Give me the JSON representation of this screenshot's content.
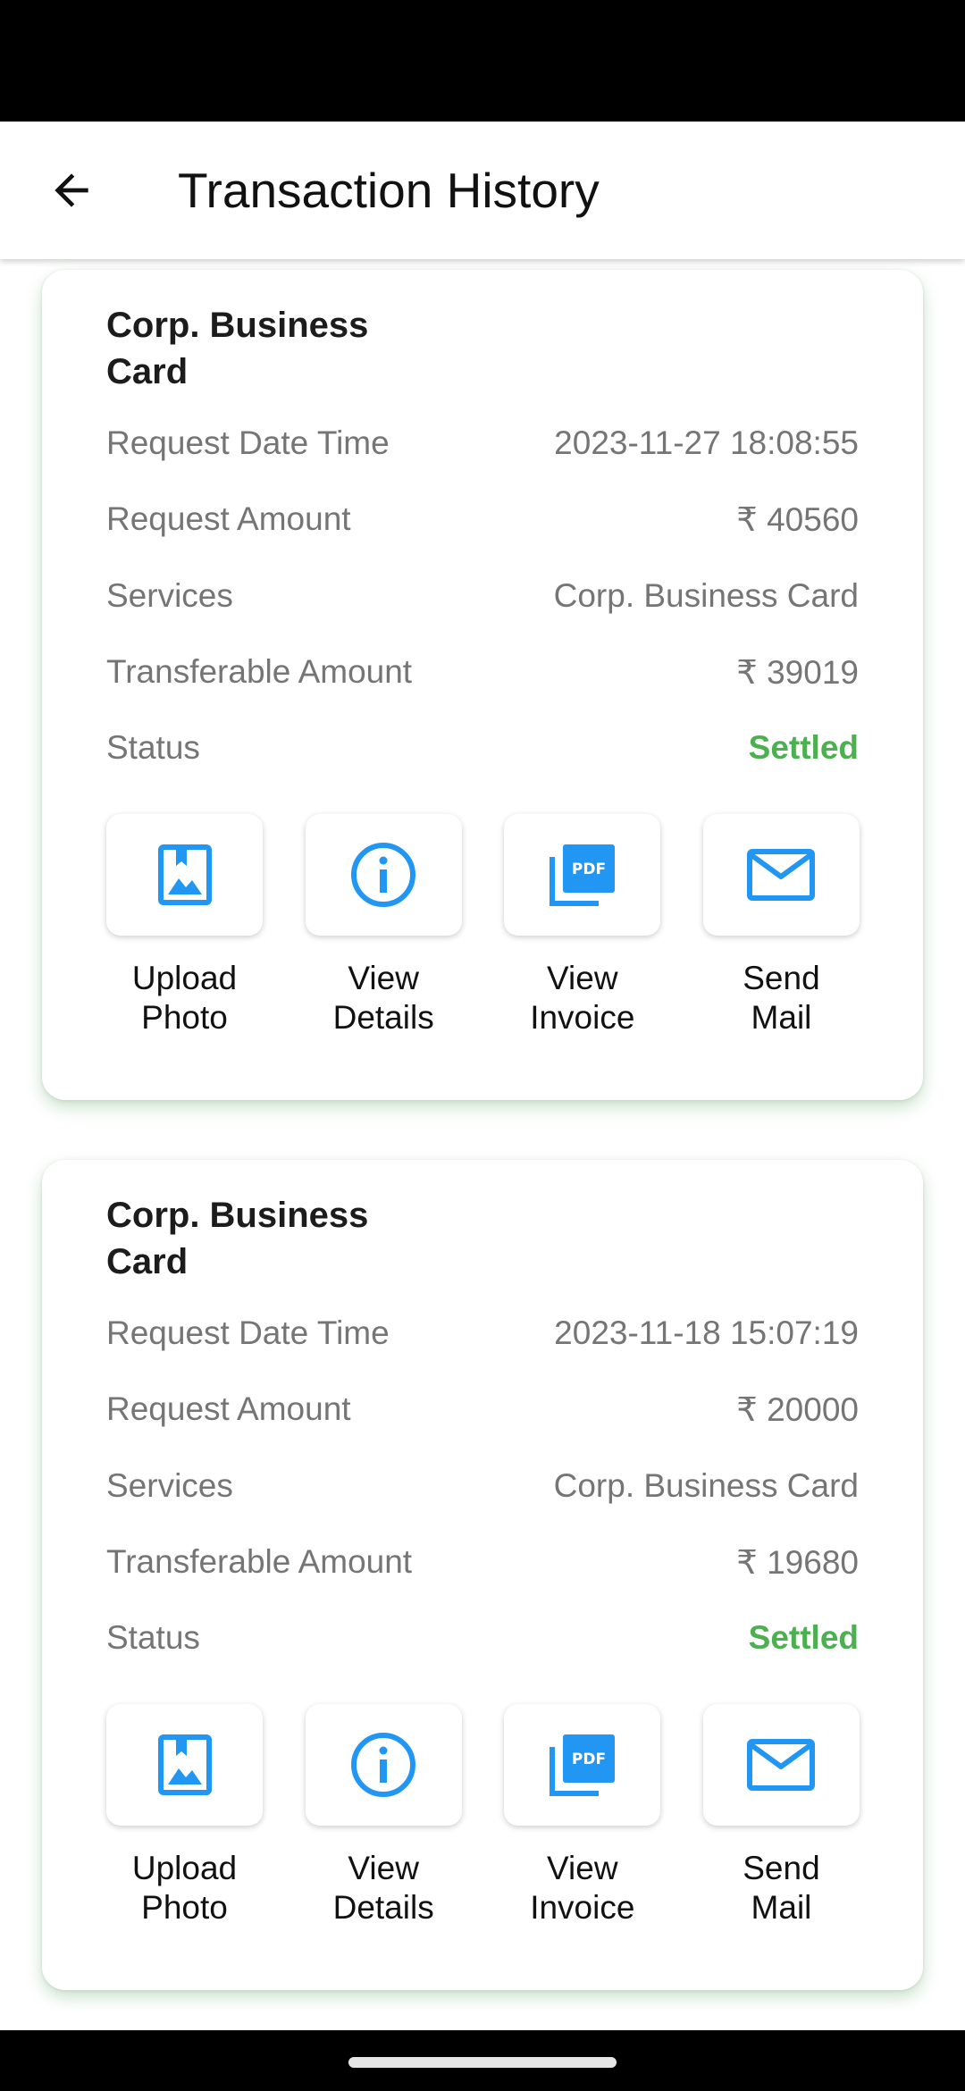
{
  "header": {
    "title": "Transaction History"
  },
  "colors": {
    "accent_icon": "#2196f3",
    "status_settled": "#4caf50",
    "label_grey": "#757575"
  },
  "cards": [
    {
      "title": "Corp. Business Card",
      "rows": [
        {
          "label": "Request Date Time",
          "value": "2023-11-27 18:08:55"
        },
        {
          "label": "Request Amount",
          "value": "₹ 40560"
        },
        {
          "label": "Services",
          "value": "Corp. Business Card"
        },
        {
          "label": "Transferable Amount",
          "value": "₹ 39019"
        },
        {
          "label": "Status",
          "value": "Settled"
        }
      ],
      "actions": [
        {
          "icon": "photo-icon",
          "line1": "Upload",
          "line2": "Photo"
        },
        {
          "icon": "info-icon",
          "line1": "View",
          "line2": "Details"
        },
        {
          "icon": "pdf-icon",
          "line1": "View",
          "line2": "Invoice"
        },
        {
          "icon": "mail-icon",
          "line1": "Send",
          "line2": "Mail"
        }
      ]
    },
    {
      "title": "Corp. Business Card",
      "rows": [
        {
          "label": "Request Date Time",
          "value": "2023-11-18 15:07:19"
        },
        {
          "label": "Request Amount",
          "value": "₹ 20000"
        },
        {
          "label": "Services",
          "value": "Corp. Business Card"
        },
        {
          "label": "Transferable Amount",
          "value": "₹ 19680"
        },
        {
          "label": "Status",
          "value": "Settled"
        }
      ],
      "actions": [
        {
          "icon": "photo-icon",
          "line1": "Upload",
          "line2": "Photo"
        },
        {
          "icon": "info-icon",
          "line1": "View",
          "line2": "Details"
        },
        {
          "icon": "pdf-icon",
          "line1": "View",
          "line2": "Invoice"
        },
        {
          "icon": "mail-icon",
          "line1": "Send",
          "line2": "Mail"
        }
      ]
    }
  ]
}
